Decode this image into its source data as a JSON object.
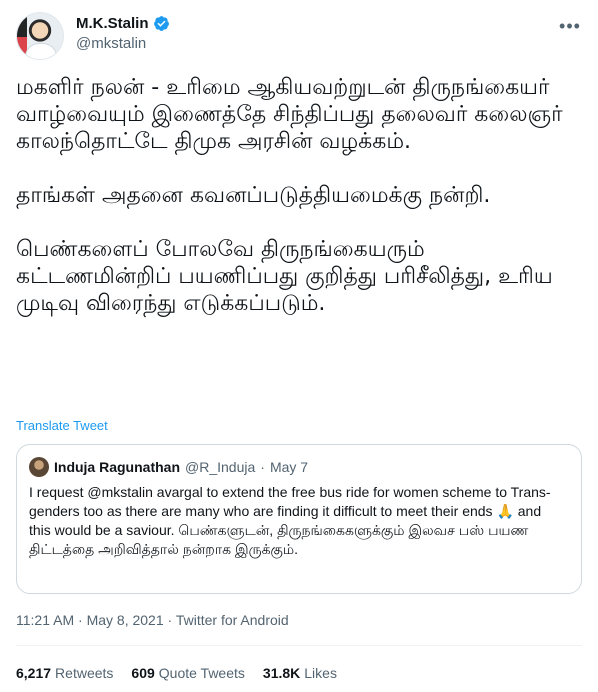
{
  "author": {
    "display_name": "M.K.Stalin",
    "handle": "@mkstalin",
    "verified": true,
    "avatar_icon": "profile-photo"
  },
  "tweet": {
    "paragraphs": [
      "மகளிர் நலன் - உரிமை ஆகியவற்றுடன் திருநங்கையர் வாழ்வையும் இணைத்தே சிந்திப்பது தலைவர் கலைஞர் காலந்தொட்டே திமுக அரசின் வழக்கம்.",
      "தாங்கள் அதனை கவனப்படுத்தியமைக்கு நன்றி.",
      "பெண்களைப் போலவே திருநங்கையரும் கட்டணமின்றிப் பயணிப்பது குறித்து பரிசீலித்து, உரிய முடிவு விரைந்து எடுக்கப்படும்."
    ],
    "translate_label": "Translate Tweet"
  },
  "quoted": {
    "name": "Induja Ragunathan",
    "handle": "@R_Induja",
    "separator": "·",
    "date": "May 7",
    "text": "I request @mkstalin avargal to extend the free bus ride for women scheme to Trans-genders too as there are many who are finding it difficult to meet their ends 🙏 and this would be a saviour. பெண்களுடன், திருநங்கைகளுக்கும் இலவச பஸ் பயண திட்டத்தை அறிவித்தால் நன்றாக இருக்கும்."
  },
  "meta": {
    "time": "11:21 AM",
    "separator": "·",
    "date": "May 8, 2021",
    "source": "Twitter for Android"
  },
  "stats": {
    "retweets_count": "6,217",
    "retweets_label": "Retweets",
    "quotes_count": "609",
    "quotes_label": "Quote Tweets",
    "likes_count": "31.8K",
    "likes_label": "Likes"
  },
  "colors": {
    "accent": "#1d9bf0",
    "secondary_text": "#536471",
    "primary_text": "#0f1419"
  }
}
